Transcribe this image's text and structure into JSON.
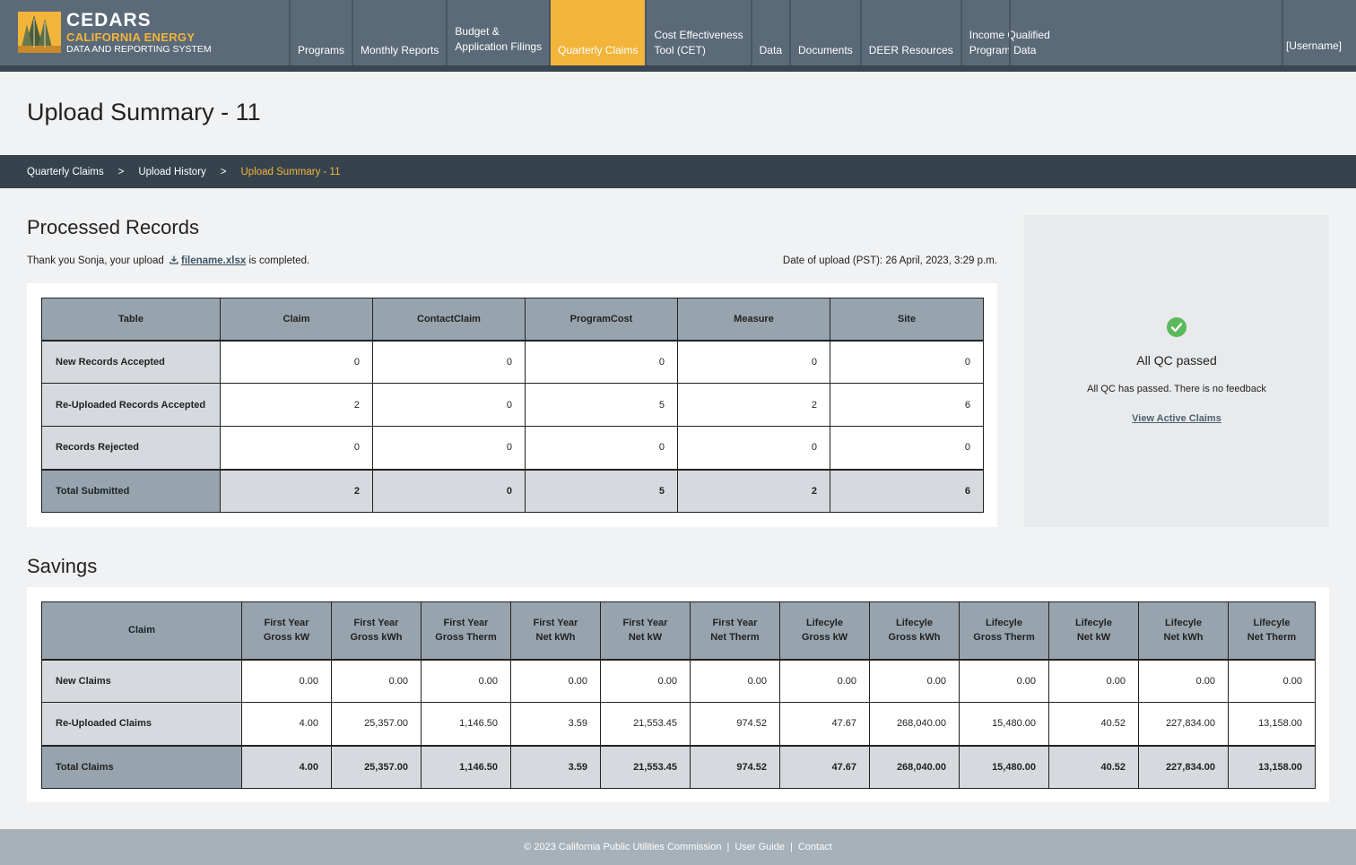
{
  "brand": {
    "line1": "CEDARS",
    "line2": "CALIFORNIA ENERGY",
    "line3": "DATA AND REPORTING SYSTEM"
  },
  "nav": {
    "items": [
      {
        "line1": "Programs",
        "line2": ""
      },
      {
        "line1": "Monthly Reports",
        "line2": ""
      },
      {
        "line1": "Budget &",
        "line2": "Application Filings"
      },
      {
        "line1": "Quarterly Claims",
        "line2": ""
      },
      {
        "line1": "Cost Effectiveness",
        "line2": "Tool (CET)"
      },
      {
        "line1": "Data",
        "line2": ""
      },
      {
        "line1": "Documents",
        "line2": ""
      },
      {
        "line1": "DEER Resources",
        "line2": ""
      },
      {
        "line1": "Income Qualified",
        "line2": "Program Data"
      }
    ],
    "user": "[Username]"
  },
  "page": {
    "title": "Upload Summary - 11"
  },
  "breadcrumb": {
    "items": [
      "Quarterly Claims",
      "Upload History",
      "Upload Summary - 11"
    ],
    "separator": ">"
  },
  "processed": {
    "heading": "Processed Records",
    "thanks_prefix": "Thank you Sonja, your upload",
    "filename": "filename.xlsx",
    "thanks_suffix": "is completed.",
    "upload_date": "Date of upload (PST): 26 April, 2023, 3:29 p.m.",
    "columns": [
      "Table",
      "Claim",
      "ContactClaim",
      "ProgramCost",
      "Measure",
      "Site"
    ],
    "rows": [
      {
        "label": "New Records Accepted",
        "values": [
          "0",
          "0",
          "0",
          "0",
          "0"
        ]
      },
      {
        "label": "Re-Uploaded Records Accepted",
        "values": [
          "2",
          "0",
          "5",
          "2",
          "6"
        ]
      },
      {
        "label": "Records Rejected",
        "values": [
          "0",
          "0",
          "0",
          "0",
          "0"
        ]
      },
      {
        "label": "Total Submitted",
        "values": [
          "2",
          "0",
          "5",
          "2",
          "6"
        ]
      }
    ]
  },
  "qc": {
    "title": "All QC passed",
    "subtitle": "All QC has passed. There is no feedback",
    "link": "View Active Claims",
    "status_color": "#5cb85c"
  },
  "savings": {
    "heading": "Savings",
    "columns": [
      {
        "l1": "Claim",
        "l2": ""
      },
      {
        "l1": "First Year",
        "l2": "Gross kW"
      },
      {
        "l1": "First Year",
        "l2": "Gross kWh"
      },
      {
        "l1": "First Year",
        "l2": "Gross Therm"
      },
      {
        "l1": "First Year",
        "l2": "Net kWh"
      },
      {
        "l1": "First Year",
        "l2": "Net kW"
      },
      {
        "l1": "First Year",
        "l2": "Net Therm"
      },
      {
        "l1": "Lifecyle",
        "l2": "Gross kW"
      },
      {
        "l1": "Lifecyle",
        "l2": "Gross kWh"
      },
      {
        "l1": "Lifecyle",
        "l2": "Gross Therm"
      },
      {
        "l1": "Lifecyle",
        "l2": "Net kW"
      },
      {
        "l1": "Lifecyle",
        "l2": "Net kWh"
      },
      {
        "l1": "Lifecyle",
        "l2": "Net Therm"
      }
    ],
    "rows": [
      {
        "label": "New Claims",
        "values": [
          "0.00",
          "0.00",
          "0.00",
          "0.00",
          "0.00",
          "0.00",
          "0.00",
          "0.00",
          "0.00",
          "0.00",
          "0.00",
          "0.00"
        ]
      },
      {
        "label": "Re-Uploaded Claims",
        "values": [
          "4.00",
          "25,357.00",
          "1,146.50",
          "3.59",
          "21,553.45",
          "974.52",
          "47.67",
          "268,040.00",
          "15,480.00",
          "40.52",
          "227,834.00",
          "13,158.00"
        ]
      },
      {
        "label": "Total Claims",
        "values": [
          "4.00",
          "25,357.00",
          "1,146.50",
          "3.59",
          "21,553.45",
          "974.52",
          "47.67",
          "268,040.00",
          "15,480.00",
          "40.52",
          "227,834.00",
          "13,158.00"
        ]
      }
    ]
  },
  "footer": {
    "copyright": "© 2023 California Public Utilities Commission",
    "user_guide": "User Guide",
    "contact": "Contact",
    "separator": "|"
  },
  "colors": {
    "header_bg": "#5b6a78",
    "accent": "#f2b53a",
    "breadcrumb_bg": "#36434d",
    "table_header": "#97a4ae",
    "row_header": "#d6dade",
    "footer_bg": "#a7b1b9"
  },
  "icons": {
    "logo": "cedars-tree-logo",
    "download": "download-icon",
    "qc_status": "check-circle-icon"
  }
}
